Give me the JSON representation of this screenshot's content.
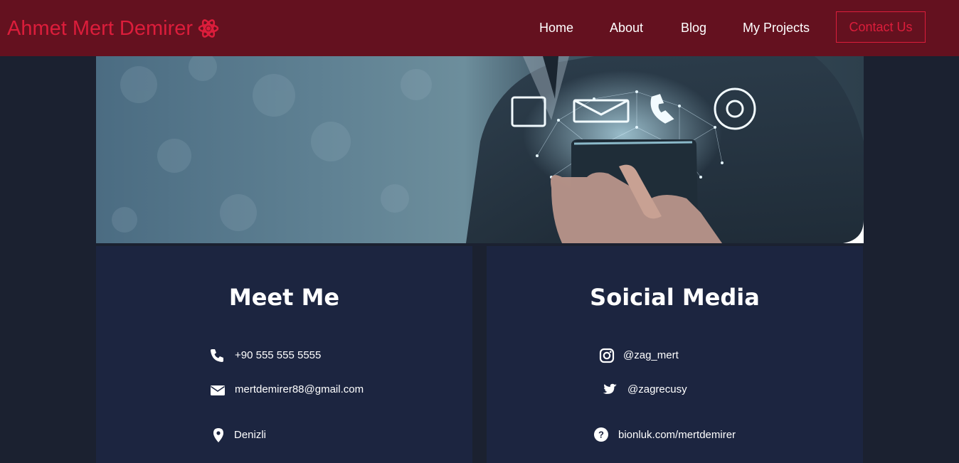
{
  "brand": {
    "name": "Ahmet Mert Demirer",
    "icon": "atom-icon",
    "color": "#dc1d3b"
  },
  "nav": {
    "items": [
      {
        "label": "Home"
      },
      {
        "label": "About"
      },
      {
        "label": "Blog"
      },
      {
        "label": "My Projects"
      }
    ],
    "contact_label": "Contact Us"
  },
  "hero": {
    "icons": [
      "tablet-icon",
      "envelope-icon",
      "phone-icon",
      "at-icon"
    ]
  },
  "meet_me": {
    "title": "Meet Me",
    "phone": "+90 555 555 5555",
    "email": "mertdemirer88@gmail.com",
    "location": "Denizli"
  },
  "social": {
    "title": "Soicial Media",
    "instagram": "@zag_mert",
    "twitter": "@zagrecusy",
    "website": "bionluk.com/mertdemirer"
  },
  "colors": {
    "navbar": "#64111f",
    "accent": "#dc1d3b",
    "page_bg": "#1b2130",
    "card_bg": "#1c2540"
  }
}
